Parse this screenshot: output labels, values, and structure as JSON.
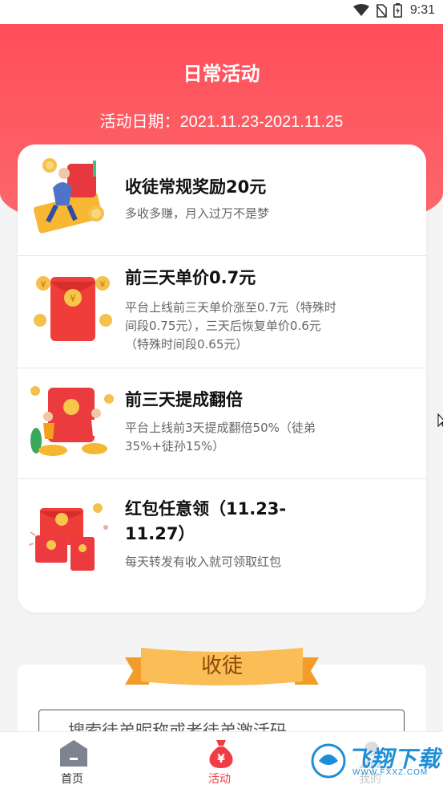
{
  "status_bar": {
    "time": "9:31"
  },
  "header": {
    "title": "日常活动",
    "date": "活动日期：2021.11.23-2021.11.25"
  },
  "activities": [
    {
      "title": "收徒常规奖励20元",
      "description": "多收多赚，月入过万不是梦",
      "icon": "person-with-coins-icon"
    },
    {
      "title": "前三天单价0.7元",
      "description": "平台上线前三天单价涨至0.7元（特殊时间段0.75元），三天后恢复单价0.6元（特殊时间段0.65元）",
      "icon": "red-envelope-icon"
    },
    {
      "title": "前三天提成翻倍",
      "description": "平台上线前3天提成翻倍50%（徒弟35%+徒孙15%）",
      "icon": "people-celebrating-icon"
    },
    {
      "title": "红包任意领（11.23-11.27）",
      "description": "每天转发有收入就可领取红包",
      "icon": "red-envelopes-icon"
    }
  ],
  "recruit_section": {
    "title": "收徒",
    "search_placeholder": "搜索徒弟昵称或者徒弟激活码"
  },
  "tabbar": [
    {
      "label": "首页",
      "icon": "home-icon",
      "active": false
    },
    {
      "label": "活动",
      "icon": "money-bag-icon",
      "active": true
    },
    {
      "label": "我的",
      "icon": "profile-icon",
      "active": false
    }
  ],
  "watermark": {
    "text": "飞翔下载",
    "url": "WWW.FXXZ.COM"
  },
  "colors": {
    "accent": "#f23c44",
    "header_bg": "#ff4e59",
    "ribbon": "#f9b54a"
  }
}
